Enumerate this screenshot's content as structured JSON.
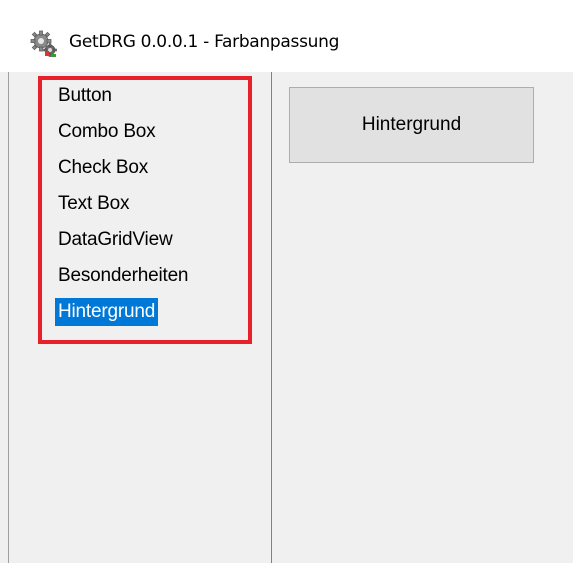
{
  "window": {
    "title": "GetDRG 0.0.0.1 - Farbanpassung",
    "icon": "gear-app-icon"
  },
  "listbox": {
    "items": [
      {
        "label": "Button",
        "selected": false
      },
      {
        "label": "Combo Box",
        "selected": false
      },
      {
        "label": "Check Box",
        "selected": false
      },
      {
        "label": "Text Box",
        "selected": false
      },
      {
        "label": "DataGridView",
        "selected": false
      },
      {
        "label": "Besonderheiten",
        "selected": false
      },
      {
        "label": "Hintergrund",
        "selected": true
      }
    ]
  },
  "main": {
    "button_label": "Hintergrund"
  },
  "colors": {
    "selection": "#0078d7",
    "highlight_border": "#e8202a",
    "window_bg": "#f0f0f0",
    "button_bg": "#e1e1e1"
  }
}
